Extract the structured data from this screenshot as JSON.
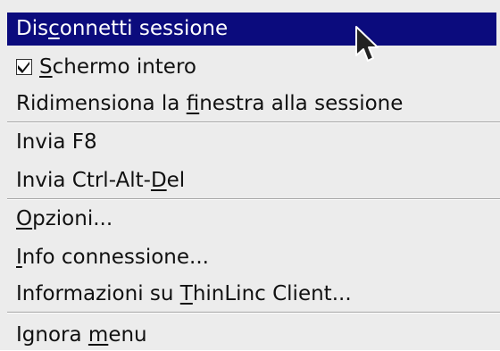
{
  "menu": {
    "items": [
      {
        "pre": "Dis",
        "accel": "c",
        "post": "onnetti sessione",
        "highlighted": true
      },
      {
        "pre": "",
        "accel": "S",
        "post": "chermo intero",
        "checked": true
      },
      {
        "pre": "Ridimensiona la ",
        "accel": "f",
        "post": "inestra alla sessione"
      },
      {
        "pre": "Invia F8",
        "accel": "",
        "post": ""
      },
      {
        "pre": "Invia Ctrl-Alt-",
        "accel": "D",
        "post": "el"
      },
      {
        "pre": "",
        "accel": "O",
        "post": "pzioni..."
      },
      {
        "pre": "",
        "accel": "I",
        "post": "nfo connessione..."
      },
      {
        "pre": "Informazioni su ",
        "accel": "T",
        "post": "hinLinc Client..."
      },
      {
        "pre": "Ignora ",
        "accel": "m",
        "post": "enu"
      }
    ]
  },
  "colors": {
    "highlight_bg": "#0b0b7d",
    "menu_bg": "#ececec",
    "text": "#111111"
  },
  "icons": {
    "check": "check-icon",
    "cursor": "mouse-pointer-icon"
  }
}
